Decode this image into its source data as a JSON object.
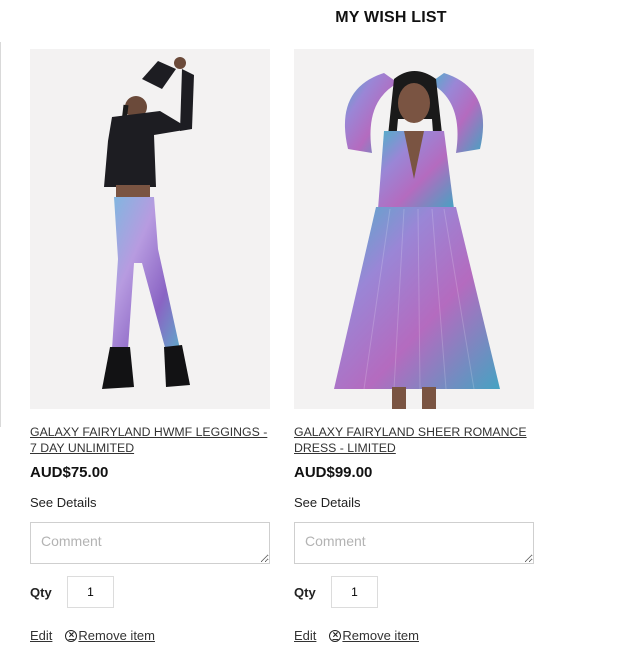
{
  "page": {
    "title": "MY WISH LIST"
  },
  "items": [
    {
      "name": "GALAXY FAIRYLAND HWMF LEGGINGS - 7 DAY UNLIMITED",
      "price": "AUD$75.00",
      "details_label": "See Details",
      "comment_placeholder": "Comment",
      "qty_label": "Qty",
      "qty": "1",
      "edit_label": "Edit",
      "remove_label": "Remove item",
      "remove_icon": "x-circle-icon"
    },
    {
      "name": "GALAXY FAIRYLAND SHEER ROMANCE DRESS - LIMITED",
      "price": "AUD$99.00",
      "details_label": "See Details",
      "comment_placeholder": "Comment",
      "qty_label": "Qty",
      "qty": "1",
      "edit_label": "Edit",
      "remove_label": "Remove item",
      "remove_icon": "x-circle-icon"
    }
  ]
}
